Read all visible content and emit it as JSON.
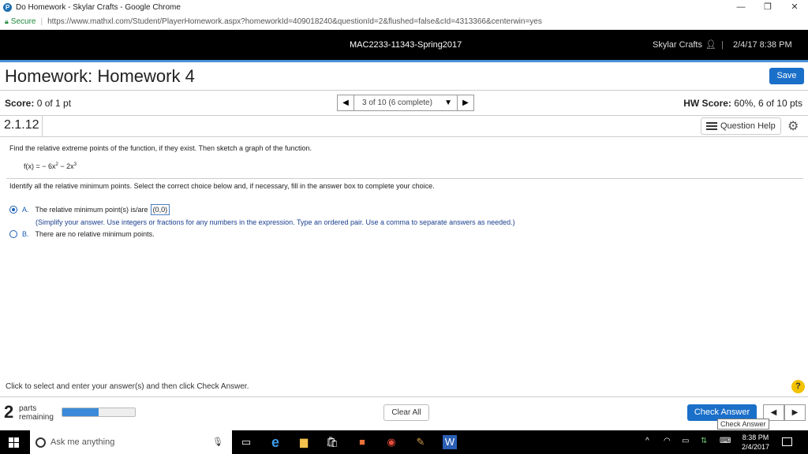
{
  "browser": {
    "tab_title": "Do Homework - Skylar Crafts - Google Chrome",
    "secure_label": "Secure",
    "url": "https://www.mathxl.com/Student/PlayerHomework.aspx?homeworkId=409018240&questionId=2&flushed=false&cId=4313366&centerwin=yes"
  },
  "header": {
    "course": "MAC2233-11343-Spring2017",
    "user": "Skylar Crafts",
    "divider": "|",
    "datetime": "2/4/17 8:38 PM"
  },
  "homework": {
    "title": "Homework: Homework 4",
    "save_label": "Save",
    "score_label": "Score:",
    "score_value": "0 of 1 pt",
    "question_select": "3 of 10 (6 complete)",
    "hw_score_label": "HW Score:",
    "hw_score_value": "60%, 6 of 10 pts",
    "question_number": "2.1.12",
    "question_help": "Question Help"
  },
  "question": {
    "prompt": "Find the relative extreme points of the function, if they exist. Then sketch a graph of the function.",
    "func_prefix": "f(x) = − 6x",
    "func_exp1": "2",
    "func_mid": " − 2x",
    "func_exp2": "3",
    "instruction": "Identify all the relative minimum points. Select the correct choice below and, if necessary, fill in the answer box to complete your choice.",
    "choice_a_letter": "A.",
    "choice_a_text": "The relative minimum point(s) is/are",
    "choice_a_answer": "(0,0)",
    "choice_a_hint": "(Simplify your answer. Use integers or fractions for any numbers in the expression. Type an ordered pair. Use a comma to separate answers as needed.)",
    "choice_b_letter": "B.",
    "choice_b_text": "There are no relative minimum points."
  },
  "footer": {
    "instruction": "Click to select and enter your answer(s) and then click Check Answer.",
    "help_glyph": "?",
    "parts_count": "2",
    "parts_label_1": "parts",
    "parts_label_2": "remaining",
    "progress_fraction": 0.5,
    "clear_label": "Clear All",
    "check_label": "Check Answer",
    "tooltip": "Check Answer"
  },
  "taskbar": {
    "search_placeholder": "Ask me anything",
    "time": "8:38 PM",
    "date": "2/4/2017"
  },
  "colors": {
    "accent": "#1a6fc9",
    "strip": "#4a90d9",
    "secure": "#1e8a3c"
  }
}
